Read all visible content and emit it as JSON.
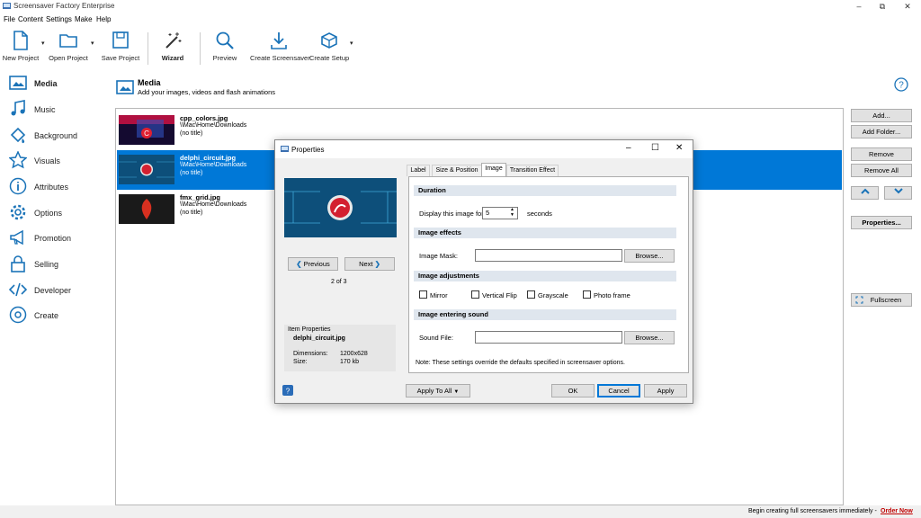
{
  "window": {
    "title": "Screensaver Factory Enterprise"
  },
  "menu": [
    "File",
    "Content",
    "Settings",
    "Make",
    "Help"
  ],
  "toolbar": {
    "new_project": "New Project",
    "open_project": "Open Project",
    "save_project": "Save Project",
    "wizard": "Wizard",
    "preview": "Preview",
    "create_screensaver": "Create Screensaver",
    "create_setup": "Create Setup"
  },
  "sidebar": [
    {
      "label": "Media",
      "icon": "media-icon"
    },
    {
      "label": "Music",
      "icon": "music-icon"
    },
    {
      "label": "Background",
      "icon": "background-icon"
    },
    {
      "label": "Visuals",
      "icon": "star-icon"
    },
    {
      "label": "Attributes",
      "icon": "info-icon"
    },
    {
      "label": "Options",
      "icon": "gear-icon"
    },
    {
      "label": "Promotion",
      "icon": "megaphone-icon"
    },
    {
      "label": "Selling",
      "icon": "lock-icon"
    },
    {
      "label": "Developer",
      "icon": "code-icon"
    },
    {
      "label": "Create",
      "icon": "disc-icon"
    }
  ],
  "main": {
    "title": "Media",
    "subtitle": "Add your images, videos and flash animations",
    "items": [
      {
        "name": "cpp_colors.jpg",
        "path": "\\\\Mac\\Home\\Downloads",
        "title": "(no title)"
      },
      {
        "name": "delphi_circuit.jpg",
        "path": "\\\\Mac\\Home\\Downloads",
        "title": "(no title)"
      },
      {
        "name": "fmx_grid.jpg",
        "path": "\\\\Mac\\Home\\Downloads",
        "title": "(no title)"
      }
    ],
    "buttons": {
      "add": "Add...",
      "add_folder": "Add Folder...",
      "remove": "Remove",
      "remove_all": "Remove All",
      "properties": "Properties...",
      "fullscreen": "Fullscreen"
    }
  },
  "dialog": {
    "title": "Properties",
    "tabs": [
      "Label",
      "Size & Position",
      "Image",
      "Transition Effect"
    ],
    "previous": "Previous",
    "next": "Next",
    "counter": "2 of 3",
    "item_properties": "Item Properties",
    "item_name": "delphi_circuit.jpg",
    "dimensions_label": "Dimensions:",
    "dimensions": "1200x628",
    "size_label": "Size:",
    "size": "170 kb",
    "duration_section": "Duration",
    "display_for": "Display this image for",
    "duration_value": "5",
    "seconds": "seconds",
    "effects_section": "Image effects",
    "image_mask": "Image Mask:",
    "browse": "Browse...",
    "adjust_section": "Image adjustments",
    "mirror": "Mirror",
    "vflip": "Vertical Flip",
    "grayscale": "Grayscale",
    "photo_frame": "Photo frame",
    "sound_section": "Image entering sound",
    "sound_file": "Sound File:",
    "note": "Note: These settings override the defaults specified in screensaver options.",
    "apply_to_all": "Apply To All",
    "ok": "OK",
    "cancel": "Cancel",
    "apply": "Apply"
  },
  "status": {
    "text": "Begin creating full screensavers immediately - ",
    "link": "Order Now"
  },
  "colors": {
    "accent": "#0078d7",
    "link": "#c00000",
    "icon": "#1a73b8"
  }
}
